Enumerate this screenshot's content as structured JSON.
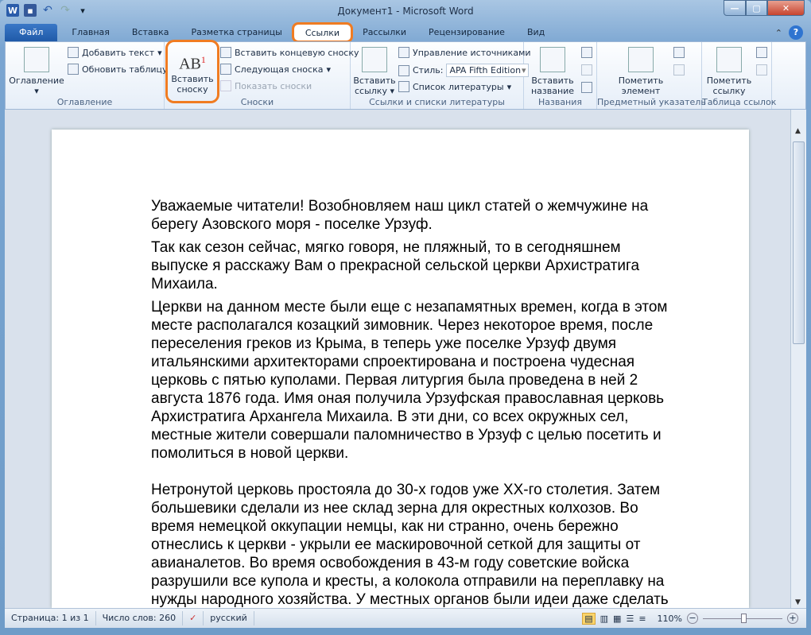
{
  "window": {
    "title": "Документ1  -  Microsoft Word",
    "minimize": "—",
    "maximize": "▢",
    "close": "✕"
  },
  "qat": {
    "app_icon": "W",
    "save": "save-icon",
    "undo": "↶",
    "redo": "↷",
    "customize": "▾"
  },
  "tabs": [
    {
      "label": "Файл"
    },
    {
      "label": "Главная"
    },
    {
      "label": "Вставка"
    },
    {
      "label": "Разметка страницы"
    },
    {
      "label": "Ссылки"
    },
    {
      "label": "Рассылки"
    },
    {
      "label": "Рецензирование"
    },
    {
      "label": "Вид"
    }
  ],
  "active_tab": "Ссылки",
  "ribbon": {
    "toc": {
      "label": "Оглавление",
      "big": "Оглавление",
      "add_text": "Добавить текст",
      "update": "Обновить таблицу"
    },
    "footnotes": {
      "label": "Сноски",
      "insert": "Вставить сноску",
      "insert_l1": "Вставить",
      "insert_l2": "сноску",
      "icon_text": "AB",
      "icon_sup": "1",
      "endnote": "Вставить концевую сноску",
      "next": "Следующая сноска",
      "show": "Показать сноски"
    },
    "citations": {
      "label": "Ссылки и списки литературы",
      "insert_l1": "Вставить",
      "insert_l2": "ссылку",
      "manage": "Управление источниками",
      "style_label": "Стиль:",
      "style_value": "APA Fifth Edition",
      "bibliography": "Список литературы"
    },
    "captions": {
      "label": "Названия",
      "insert_l1": "Вставить",
      "insert_l2": "название"
    },
    "index": {
      "label": "Предметный указатель",
      "mark_l1": "Пометить",
      "mark_l2": "элемент"
    },
    "toa": {
      "label": "Таблица ссылок",
      "mark_l1": "Пометить",
      "mark_l2": "ссылку"
    }
  },
  "document": {
    "paragraphs": [
      [
        "Уважаемые читатели! Возобновляем наш цикл статей о жемчужине на",
        "берегу Азовского моря - поселке Урзуф."
      ],
      [
        "Так как сезон сейчас, мягко говоря, не пляжный, то в сегодняшнем",
        "выпуске я расскажу Вам о прекрасной сельской церкви Архистратига",
        "Михаила."
      ],
      [
        "Церкви на данном месте были еще с незапамятных времен, когда в этом",
        "месте располагался козацкий зимовник. Через некоторое время, после",
        "переселения греков из Крыма, в теперь уже поселке Урзуф двумя",
        "итальянскими архитекторами спроектирована и построена чудесная",
        "церковь с пятью куполами. Первая литургия была проведена в ней 2",
        "августа 1876 года. Имя оная получила Урзуфская православная церковь",
        "Архистратига Архангела Михаила. В эти дни, со всех окружных сел,",
        "местные жители совершали паломничество в Урзуф с целью посетить и",
        "помолиться в новой церкви."
      ],
      [
        "Нетронутой церковь простояла до 30-х годов уже XX-го столетия. Затем",
        "большевики сделали из нее склад зерна для окрестных колхозов. Во",
        "время немецкой оккупации немцы, как ни странно, очень бережно",
        "отнеслись к церкви - укрыли ее маскировочной сеткой для защиты от",
        "авианалетов. Во время освобождения в 43-м году советские войска",
        "разрушили все купола и кресты, а колокола отправили на переплавку на",
        "нужды народного хозяйства. У местных органов были идеи даже сделать"
      ]
    ]
  },
  "status": {
    "page": "Страница: 1 из 1",
    "words": "Число слов: 260",
    "language": "русский",
    "zoom": "110%",
    "zoom_minus": "−",
    "zoom_plus": "+",
    "zoom_percent": 110
  },
  "colors": {
    "highlight": "#f07c22",
    "file_tab": "#2a67b6"
  }
}
